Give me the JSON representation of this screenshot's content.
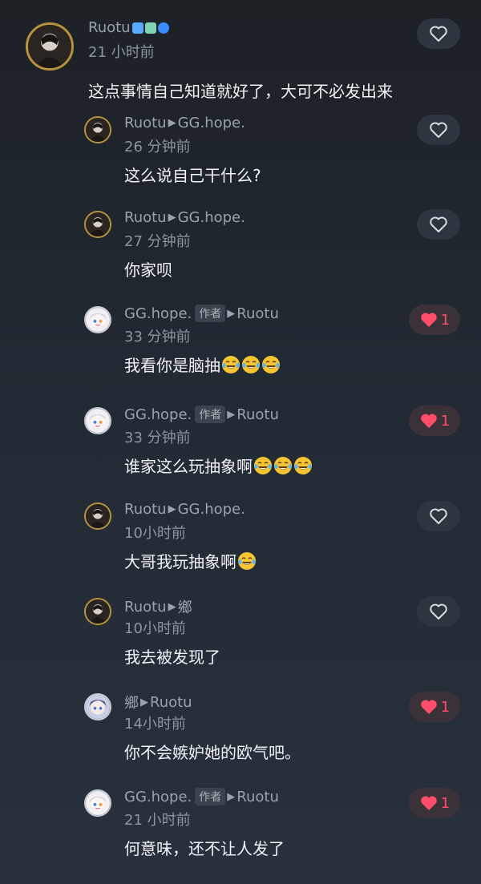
{
  "main_comment": {
    "username": "Ruotu",
    "time": "21 小时前",
    "text": "这点事情自己知道就好了，大可不必发出来",
    "liked": false
  },
  "replies": [
    {
      "from": "Ruotu",
      "to": "GG.hope.",
      "author_tag": "",
      "time": "26 分钟前",
      "text": "这么说自己干什么?",
      "emojis": 0,
      "liked": false,
      "likes": "",
      "avatar": "dark"
    },
    {
      "from": "Ruotu",
      "to": "GG.hope.",
      "author_tag": "",
      "time": "27 分钟前",
      "text": "你家呗",
      "emojis": 0,
      "liked": false,
      "likes": "",
      "avatar": "dark"
    },
    {
      "from": "GG.hope.",
      "to": "Ruotu",
      "author_tag": "作者",
      "time": "33 分钟前",
      "text": "我看你是脑抽",
      "emojis": 3,
      "liked": true,
      "likes": "1",
      "avatar": "anime"
    },
    {
      "from": "GG.hope.",
      "to": "Ruotu",
      "author_tag": "作者",
      "time": "33 分钟前",
      "text": "谁家这么玩抽象啊",
      "emojis": 3,
      "liked": true,
      "likes": "1",
      "avatar": "anime"
    },
    {
      "from": "Ruotu",
      "to": "GG.hope.",
      "author_tag": "",
      "time": "10小时前",
      "text": "大哥我玩抽象啊",
      "emojis": 1,
      "liked": false,
      "likes": "",
      "avatar": "dark"
    },
    {
      "from": "Ruotu",
      "to": "鄉",
      "author_tag": "",
      "time": "10小时前",
      "text": "我去被发现了",
      "emojis": 0,
      "liked": false,
      "likes": "",
      "avatar": "dark"
    },
    {
      "from": "鄉",
      "to": "Ruotu",
      "author_tag": "",
      "time": "14小时前",
      "text": "你不会嫉妒她的欧气吧。",
      "emojis": 0,
      "liked": true,
      "likes": "1",
      "avatar": "anime2"
    },
    {
      "from": "GG.hope.",
      "to": "Ruotu",
      "author_tag": "作者",
      "time": "21 小时前",
      "text": "何意味，还不让人发了",
      "emojis": 0,
      "liked": true,
      "likes": "1",
      "avatar": "anime"
    }
  ],
  "icons": {
    "heart": "heart-icon",
    "emoji": "laughing-tears-emoji",
    "arrow": "reply-arrow-icon"
  },
  "colors": {
    "like_red": "#ff4d6a",
    "author_tag_bg": "#3b434c",
    "avatar_ring": "#b8933c"
  }
}
